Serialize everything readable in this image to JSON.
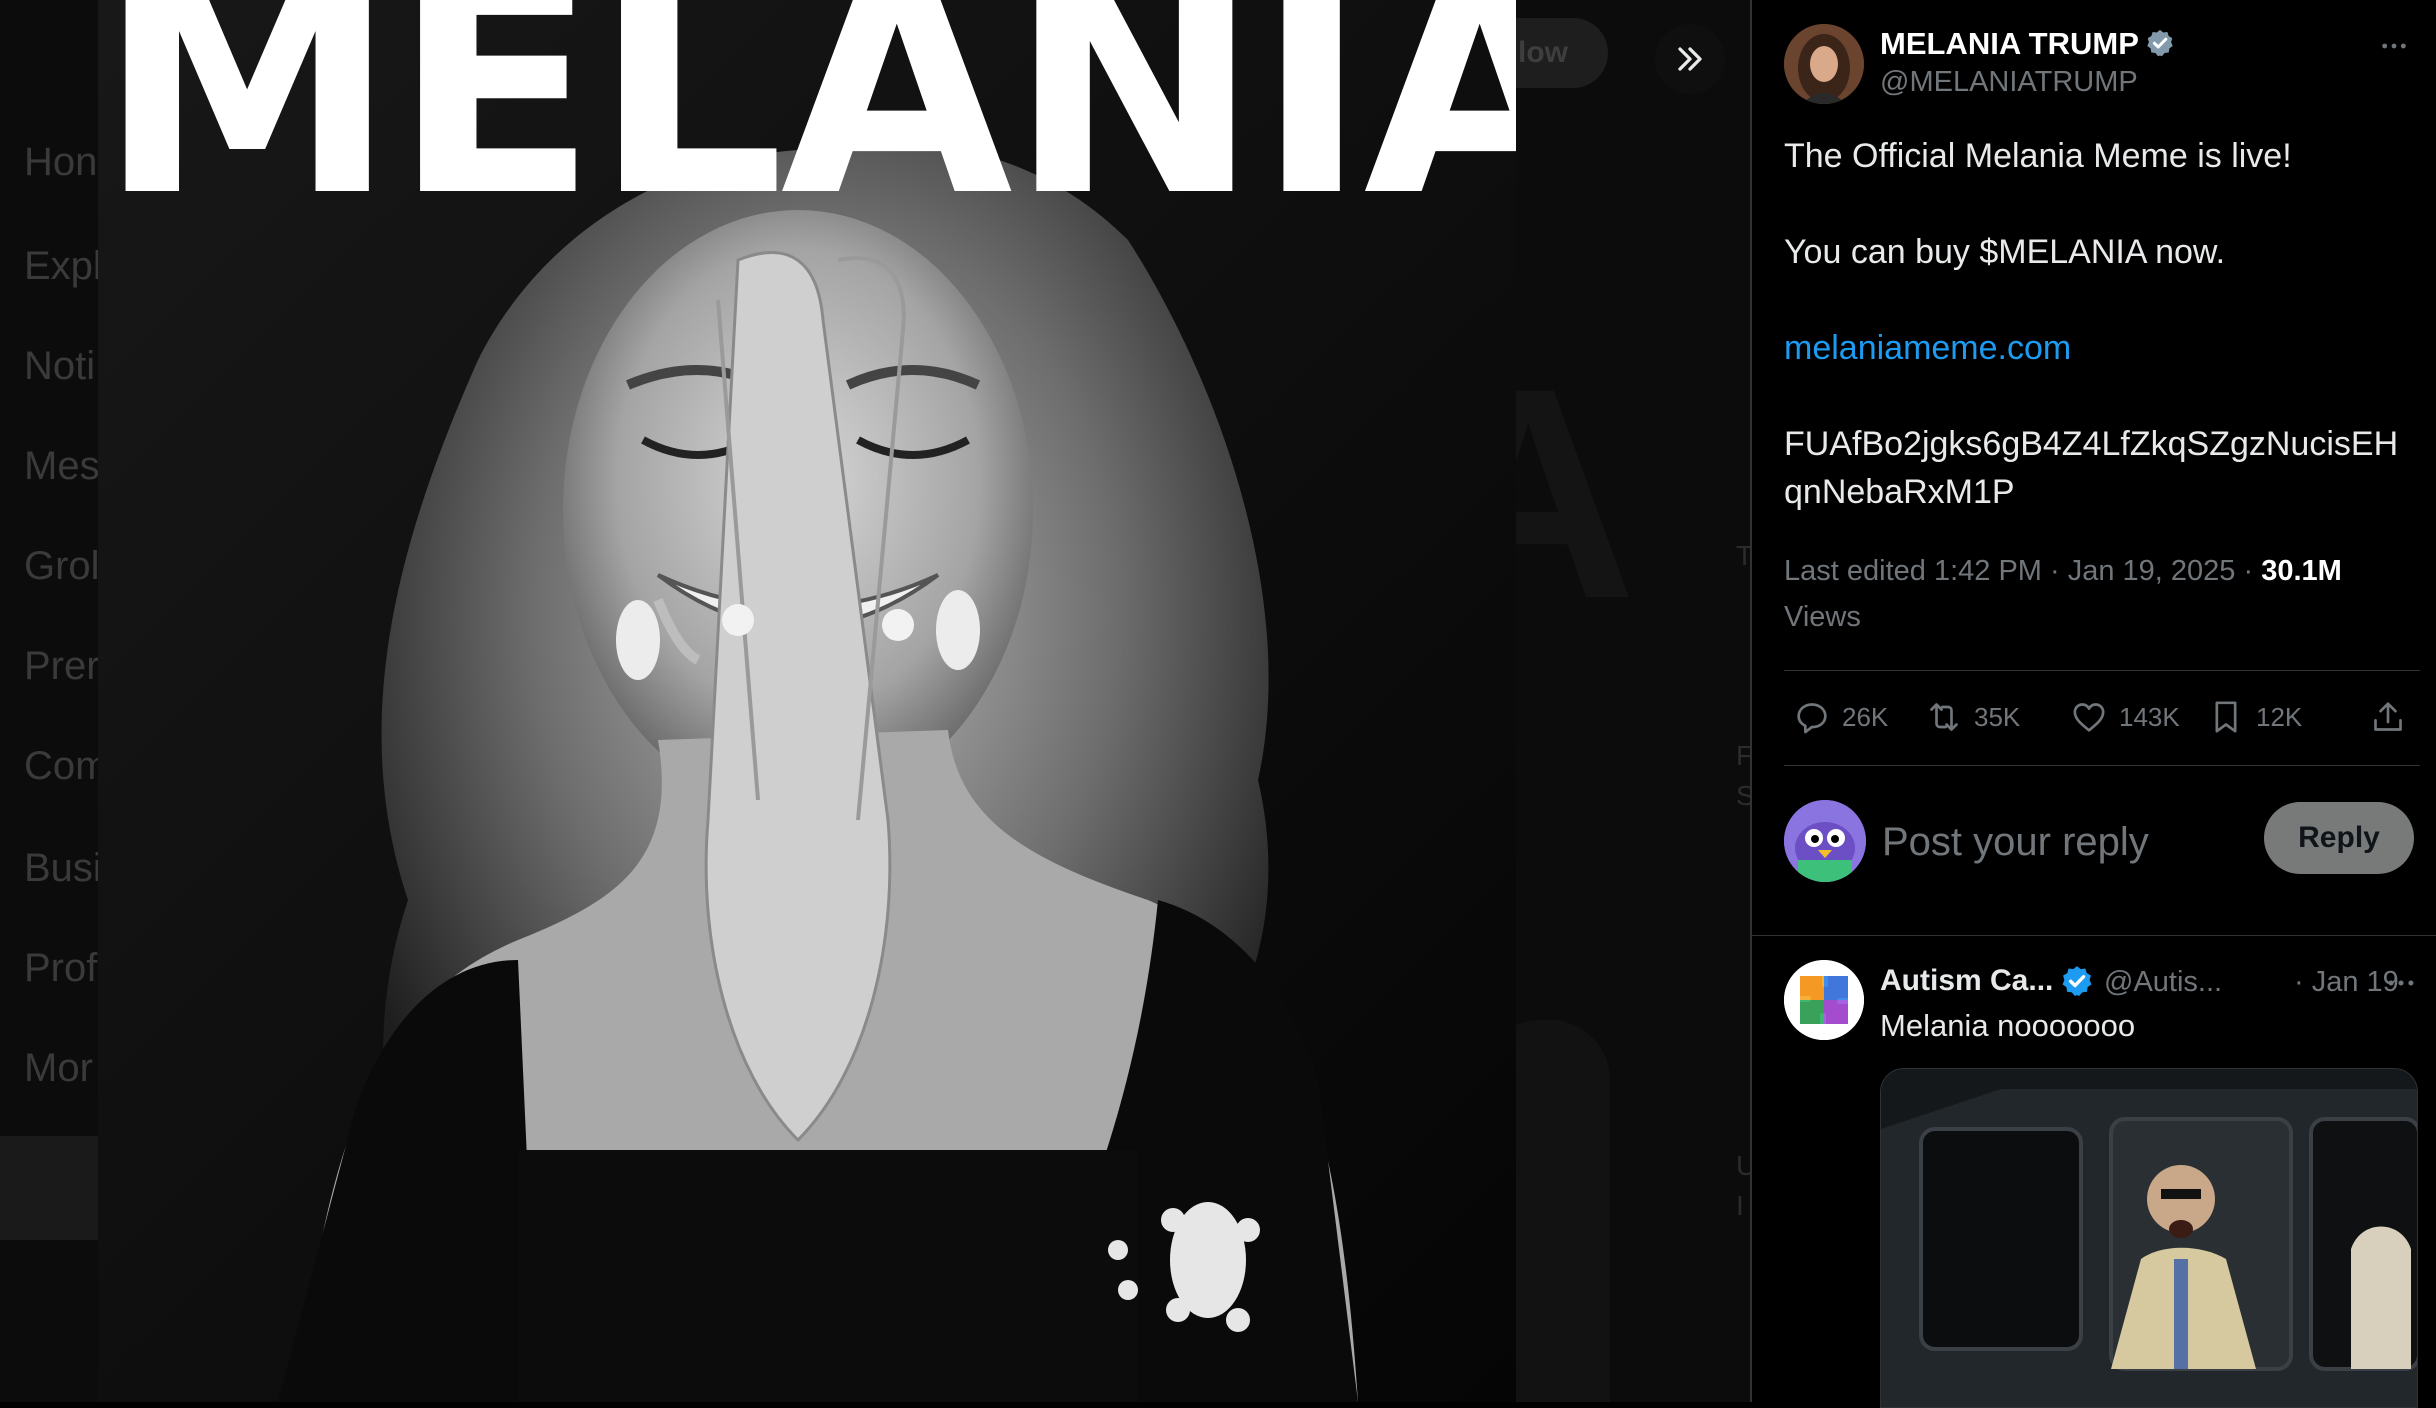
{
  "background": {
    "nav_fragments": [
      "Hon",
      "Expl",
      "Noti",
      "Mes",
      "Grol",
      "Prer",
      "Com",
      "Busi",
      "Prof",
      "Mor"
    ],
    "follow_fragment": "llow",
    "side_letters": [
      "T",
      "F",
      "S",
      "U",
      "I"
    ]
  },
  "media": {
    "title_text": "MELANIA"
  },
  "icons": {
    "collapse": "chevrons-right-icon",
    "verified": "verified-badge-icon",
    "more": "more-horizontal-icon",
    "reply": "comment-icon",
    "repost": "repost-icon",
    "like": "heart-icon",
    "bookmark": "bookmark-icon",
    "share": "share-icon"
  },
  "colors": {
    "accent": "#1d9bf0",
    "verified_gold": "#829aab",
    "muted": "#71767b"
  },
  "post": {
    "author_name": "MELANIA TRUMP",
    "author_handle": "@MELANIATRUMP",
    "line1": "The Official Melania Meme is live!",
    "line2": "You can buy $MELANIA now.",
    "link": "melaniameme.com",
    "address": "FUAfBo2jgks6gB4Z4LfZkqSZgzNucisEHqnNebaRxM1P",
    "meta_prefix": "Last edited 1:42 PM · Jan 19, 2025 · ",
    "views_count": "30.1M",
    "views_label": "Views"
  },
  "actions": {
    "replies": "26K",
    "reposts": "35K",
    "likes": "143K",
    "bookmarks": "12K"
  },
  "composer": {
    "placeholder": "Post your reply",
    "button_label": "Reply"
  },
  "reply": {
    "name": "Autism Ca...",
    "handle": "@Autis...",
    "date": "· Jan 19",
    "text": "Melania nooooooo"
  }
}
